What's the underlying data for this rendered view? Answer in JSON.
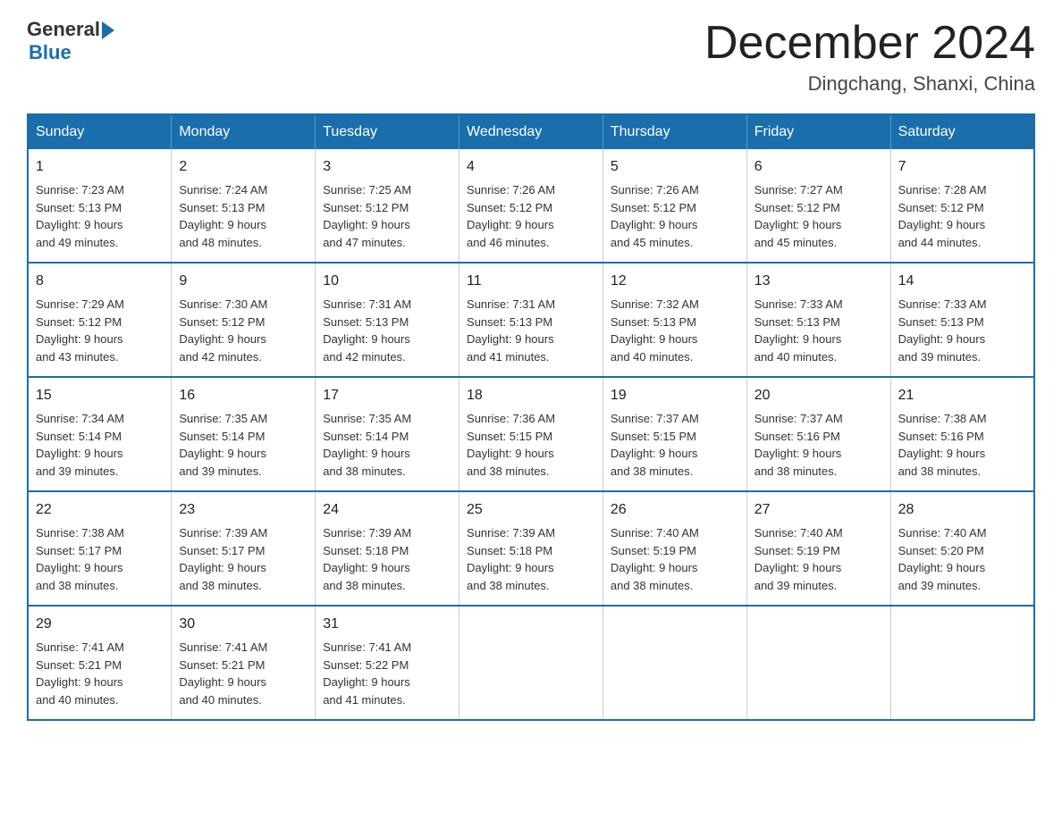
{
  "logo": {
    "general": "General",
    "blue": "Blue"
  },
  "header": {
    "title": "December 2024",
    "location": "Dingchang, Shanxi, China"
  },
  "weekdays": [
    "Sunday",
    "Monday",
    "Tuesday",
    "Wednesday",
    "Thursday",
    "Friday",
    "Saturday"
  ],
  "weeks": [
    [
      {
        "day": "1",
        "sunrise": "7:23 AM",
        "sunset": "5:13 PM",
        "daylight": "9 hours and 49 minutes."
      },
      {
        "day": "2",
        "sunrise": "7:24 AM",
        "sunset": "5:13 PM",
        "daylight": "9 hours and 48 minutes."
      },
      {
        "day": "3",
        "sunrise": "7:25 AM",
        "sunset": "5:12 PM",
        "daylight": "9 hours and 47 minutes."
      },
      {
        "day": "4",
        "sunrise": "7:26 AM",
        "sunset": "5:12 PM",
        "daylight": "9 hours and 46 minutes."
      },
      {
        "day": "5",
        "sunrise": "7:26 AM",
        "sunset": "5:12 PM",
        "daylight": "9 hours and 45 minutes."
      },
      {
        "day": "6",
        "sunrise": "7:27 AM",
        "sunset": "5:12 PM",
        "daylight": "9 hours and 45 minutes."
      },
      {
        "day": "7",
        "sunrise": "7:28 AM",
        "sunset": "5:12 PM",
        "daylight": "9 hours and 44 minutes."
      }
    ],
    [
      {
        "day": "8",
        "sunrise": "7:29 AM",
        "sunset": "5:12 PM",
        "daylight": "9 hours and 43 minutes."
      },
      {
        "day": "9",
        "sunrise": "7:30 AM",
        "sunset": "5:12 PM",
        "daylight": "9 hours and 42 minutes."
      },
      {
        "day": "10",
        "sunrise": "7:31 AM",
        "sunset": "5:13 PM",
        "daylight": "9 hours and 42 minutes."
      },
      {
        "day": "11",
        "sunrise": "7:31 AM",
        "sunset": "5:13 PM",
        "daylight": "9 hours and 41 minutes."
      },
      {
        "day": "12",
        "sunrise": "7:32 AM",
        "sunset": "5:13 PM",
        "daylight": "9 hours and 40 minutes."
      },
      {
        "day": "13",
        "sunrise": "7:33 AM",
        "sunset": "5:13 PM",
        "daylight": "9 hours and 40 minutes."
      },
      {
        "day": "14",
        "sunrise": "7:33 AM",
        "sunset": "5:13 PM",
        "daylight": "9 hours and 39 minutes."
      }
    ],
    [
      {
        "day": "15",
        "sunrise": "7:34 AM",
        "sunset": "5:14 PM",
        "daylight": "9 hours and 39 minutes."
      },
      {
        "day": "16",
        "sunrise": "7:35 AM",
        "sunset": "5:14 PM",
        "daylight": "9 hours and 39 minutes."
      },
      {
        "day": "17",
        "sunrise": "7:35 AM",
        "sunset": "5:14 PM",
        "daylight": "9 hours and 38 minutes."
      },
      {
        "day": "18",
        "sunrise": "7:36 AM",
        "sunset": "5:15 PM",
        "daylight": "9 hours and 38 minutes."
      },
      {
        "day": "19",
        "sunrise": "7:37 AM",
        "sunset": "5:15 PM",
        "daylight": "9 hours and 38 minutes."
      },
      {
        "day": "20",
        "sunrise": "7:37 AM",
        "sunset": "5:16 PM",
        "daylight": "9 hours and 38 minutes."
      },
      {
        "day": "21",
        "sunrise": "7:38 AM",
        "sunset": "5:16 PM",
        "daylight": "9 hours and 38 minutes."
      }
    ],
    [
      {
        "day": "22",
        "sunrise": "7:38 AM",
        "sunset": "5:17 PM",
        "daylight": "9 hours and 38 minutes."
      },
      {
        "day": "23",
        "sunrise": "7:39 AM",
        "sunset": "5:17 PM",
        "daylight": "9 hours and 38 minutes."
      },
      {
        "day": "24",
        "sunrise": "7:39 AM",
        "sunset": "5:18 PM",
        "daylight": "9 hours and 38 minutes."
      },
      {
        "day": "25",
        "sunrise": "7:39 AM",
        "sunset": "5:18 PM",
        "daylight": "9 hours and 38 minutes."
      },
      {
        "day": "26",
        "sunrise": "7:40 AM",
        "sunset": "5:19 PM",
        "daylight": "9 hours and 38 minutes."
      },
      {
        "day": "27",
        "sunrise": "7:40 AM",
        "sunset": "5:19 PM",
        "daylight": "9 hours and 39 minutes."
      },
      {
        "day": "28",
        "sunrise": "7:40 AM",
        "sunset": "5:20 PM",
        "daylight": "9 hours and 39 minutes."
      }
    ],
    [
      {
        "day": "29",
        "sunrise": "7:41 AM",
        "sunset": "5:21 PM",
        "daylight": "9 hours and 40 minutes."
      },
      {
        "day": "30",
        "sunrise": "7:41 AM",
        "sunset": "5:21 PM",
        "daylight": "9 hours and 40 minutes."
      },
      {
        "day": "31",
        "sunrise": "7:41 AM",
        "sunset": "5:22 PM",
        "daylight": "9 hours and 41 minutes."
      },
      null,
      null,
      null,
      null
    ]
  ]
}
